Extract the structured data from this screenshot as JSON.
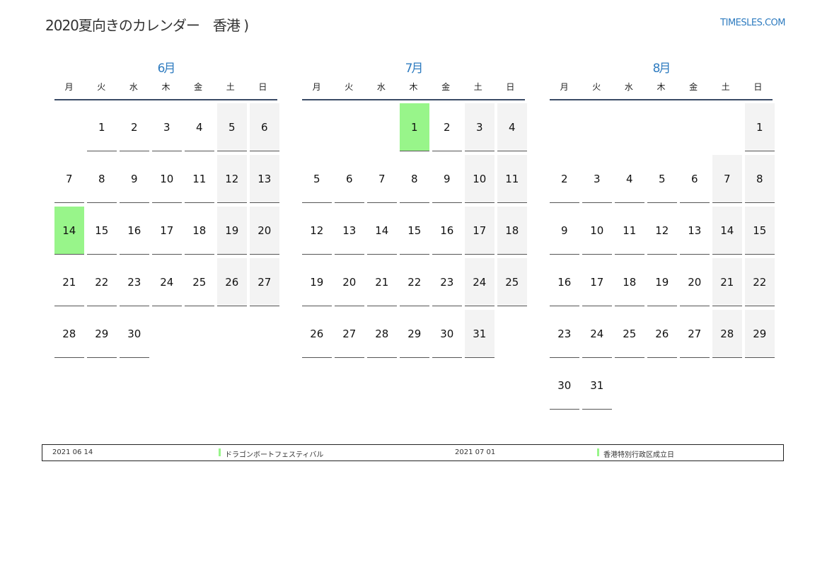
{
  "title": "2020夏向きのカレンダー　香港 )",
  "brand": "TIMESLES.COM",
  "weekdays": [
    "月",
    "火",
    "水",
    "木",
    "金",
    "土",
    "日"
  ],
  "months": [
    {
      "name": "6月",
      "weeks": [
        [
          "",
          "1",
          "2",
          "3",
          "4",
          "5",
          "6"
        ],
        [
          "7",
          "8",
          "9",
          "10",
          "11",
          "12",
          "13"
        ],
        [
          "14",
          "15",
          "16",
          "17",
          "18",
          "19",
          "20"
        ],
        [
          "21",
          "22",
          "23",
          "24",
          "25",
          "26",
          "27"
        ],
        [
          "28",
          "29",
          "30",
          "",
          "",
          "",
          ""
        ]
      ],
      "holidays": [
        "14"
      ]
    },
    {
      "name": "7月",
      "weeks": [
        [
          "",
          "",
          "",
          "1",
          "2",
          "3",
          "4"
        ],
        [
          "5",
          "6",
          "7",
          "8",
          "9",
          "10",
          "11"
        ],
        [
          "12",
          "13",
          "14",
          "15",
          "16",
          "17",
          "18"
        ],
        [
          "19",
          "20",
          "21",
          "22",
          "23",
          "24",
          "25"
        ],
        [
          "26",
          "27",
          "28",
          "29",
          "30",
          "31",
          ""
        ]
      ],
      "holidays": [
        "1"
      ]
    },
    {
      "name": "8月",
      "weeks": [
        [
          "",
          "",
          "",
          "",
          "",
          "",
          "1"
        ],
        [
          "2",
          "3",
          "4",
          "5",
          "6",
          "7",
          "8"
        ],
        [
          "9",
          "10",
          "11",
          "12",
          "13",
          "14",
          "15"
        ],
        [
          "16",
          "17",
          "18",
          "19",
          "20",
          "21",
          "22"
        ],
        [
          "23",
          "24",
          "25",
          "26",
          "27",
          "28",
          "29"
        ],
        [
          "30",
          "31",
          "",
          "",
          "",
          "",
          ""
        ]
      ],
      "holidays": []
    }
  ],
  "legend": [
    {
      "date": "2021 06 14",
      "name": "ドラゴンボートフェスティバル"
    },
    {
      "date": "2021 07 01",
      "name": "香港特別行政区成立日"
    }
  ],
  "colors": {
    "accent": "#2f7cc0",
    "holiday": "#98f58a",
    "weekend": "#f3f3f3",
    "rule": "#3a4a66"
  }
}
